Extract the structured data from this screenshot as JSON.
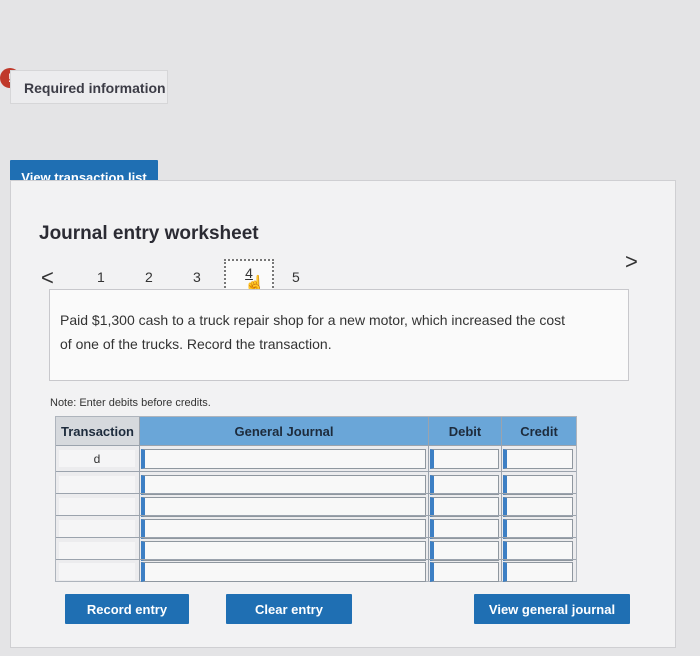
{
  "alert": {
    "glyph": "!"
  },
  "required": {
    "label": "Required information"
  },
  "actions": {
    "view_transaction_list": "View transaction list"
  },
  "worksheet": {
    "title": "Journal entry worksheet",
    "nav": {
      "prev": "<",
      "next": ">"
    },
    "pages": [
      "1",
      "2",
      "3",
      "4",
      "5"
    ],
    "current_page": "4",
    "description": "Paid $1,300 cash to a truck repair shop for a new motor, which increased the cost of one of the trucks. Record the transaction.",
    "note": "Note: Enter debits before credits.",
    "table": {
      "headers": {
        "transaction": "Transaction",
        "account": "General Journal",
        "debit": "Debit",
        "credit": "Credit"
      },
      "rows": [
        {
          "transaction": "d",
          "account": "",
          "debit": "",
          "credit": ""
        },
        {
          "transaction": "",
          "account": "",
          "debit": "",
          "credit": ""
        },
        {
          "transaction": "",
          "account": "",
          "debit": "",
          "credit": ""
        },
        {
          "transaction": "",
          "account": "",
          "debit": "",
          "credit": ""
        },
        {
          "transaction": "",
          "account": "",
          "debit": "",
          "credit": ""
        },
        {
          "transaction": "",
          "account": "",
          "debit": "",
          "credit": ""
        }
      ]
    },
    "buttons": {
      "record": "Record entry",
      "clear": "Clear entry",
      "view_journal": "View general journal"
    }
  },
  "colors": {
    "accent": "#1f6fb3",
    "header": "#6aa6d8",
    "alert": "#c0392b"
  },
  "icons": {
    "cursor": "hand-pointer-icon"
  }
}
